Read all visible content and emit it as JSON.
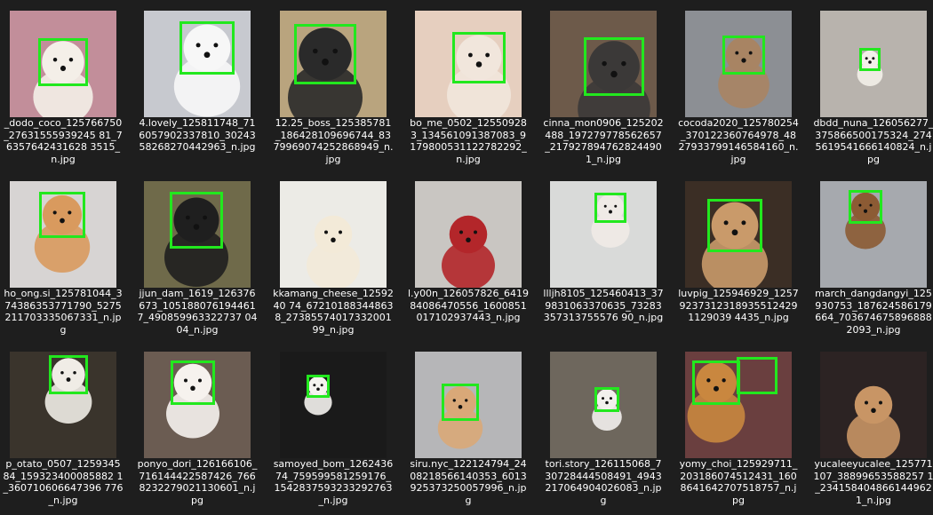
{
  "explorer": {
    "accent": "#22e81e",
    "items": [
      {
        "name": "_dodo_coco_125766750_27631555939245 81_76357642431628 3515_n.jpg",
        "icon": "dog-photo-icon",
        "bg": "#c28e9a",
        "dog": "#f4efe8"
      },
      {
        "name": "4.lovely_125811748_716057902337810_3024358268270442963_n.jpg",
        "icon": "dog-photo-icon",
        "bg": "#c7c9cf",
        "dog": "#f7f7f7"
      },
      {
        "name": "12.25_boss_125385781_186428109696744_8379969074252868949_n.jpg",
        "icon": "dog-photo-icon",
        "bg": "#b9a47e",
        "dog": "#2a2a2a"
      },
      {
        "name": "bo_me_0502_125509283_134561091387083_9179800531122782292_n.jpg",
        "icon": "dog-photo-icon",
        "bg": "#e6cfbf",
        "dog": "#f1e6dc"
      },
      {
        "name": "cinna_mon0906_125202488_197279778562657_2179278947628244901_n.jpg",
        "icon": "dog-photo-icon",
        "bg": "#6d5a4a",
        "dog": "#3b3938"
      },
      {
        "name": "cocoda2020_125780254_370122360764978_4827933799146584160_n.jpg",
        "icon": "dog-photo-icon",
        "bg": "#8c8f94",
        "dog": "#a88463"
      },
      {
        "name": "dbdd_nuna_126056277_375866500175324_2745619541666140824_n.jpg",
        "icon": "dog-photo-icon",
        "bg": "#b8b3ad",
        "dog": "#f3efe9"
      },
      {
        "name": "ho_ong.si_125781044_374386353771790_5275211703335067331_n.jpg",
        "icon": "dog-photo-icon",
        "bg": "#d7d4d3",
        "dog": "#d99a5e"
      },
      {
        "name": "jjun_dam_1619_126376673_105188076194461 7_490859963322737 0404_n.jpg",
        "icon": "dog-photo-icon",
        "bg": "#6f6a4a",
        "dog": "#1f1f1f"
      },
      {
        "name": "kkamang_cheese_1259240 74_672101883448638_2738557401733200199_n.jpg",
        "icon": "dog-photo-icon",
        "bg": "#ecebe6",
        "dog": "#f3ead8"
      },
      {
        "name": "l.y00n_126057826_641984086470556_1600851017102937443_n.jpg",
        "icon": "dog-photo-icon",
        "bg": "#c9c6c2",
        "dog": "#b3262a"
      },
      {
        "name": "llljh8105_125460413_379831063370635_73283357313755576 90_n.jpg",
        "icon": "dog-photo-icon",
        "bg": "#d9dad9",
        "dog": "#efeae6"
      },
      {
        "name": "luvpig_125946929_125792373123189355124291129039 4435_n.jpg",
        "icon": "dog-photo-icon",
        "bg": "#3b2e25",
        "dog": "#c99a6a"
      },
      {
        "name": "march_dangdangyi_125930753_187624586179664_7036746758968882093_n.jpg",
        "icon": "dog-photo-icon",
        "bg": "#a6a9ae",
        "dog": "#8c5b34"
      },
      {
        "name": "p_otato_0507_125934584_159323400085882 1_360710606647396 776_n.jpg",
        "icon": "dog-photo-icon",
        "bg": "#3a342c",
        "dog": "#f0ece6"
      },
      {
        "name": "ponyo_dori_126166106_716144422587426_7668232279021130601_n.jpg",
        "icon": "dog-photo-icon",
        "bg": "#6b5c52",
        "dog": "#f6f2ee"
      },
      {
        "name": "samoyed_bom_126243674_759599581259176_1542837593233292763_n.jpg",
        "icon": "dog-photo-icon",
        "bg": "#1a1a1a",
        "dog": "#f5f3ef"
      },
      {
        "name": "siru.nyc_122124794_2408218566140353_6013925373250057996_n.jpg",
        "icon": "dog-photo-icon",
        "bg": "#b6b6b8",
        "dog": "#d9a878"
      },
      {
        "name": "tori.story_126115068_730728444508491_4943217064904026083_n.jpg",
        "icon": "dog-photo-icon",
        "bg": "#6e675d",
        "dog": "#f2f0ed"
      },
      {
        "name": "yomy_choi_125929711_203186074512431_1608641642707518757_n.jpg",
        "icon": "dog-photo-icon",
        "bg": "#6a3f3f",
        "dog": "#c9873f"
      },
      {
        "name": "yucaleeyucalee_125771107_38899653588257 1_2341584048661449621_n.jpg",
        "icon": "dog-photo-icon",
        "bg": "#2c2323",
        "dog": "#c89565"
      }
    ]
  }
}
